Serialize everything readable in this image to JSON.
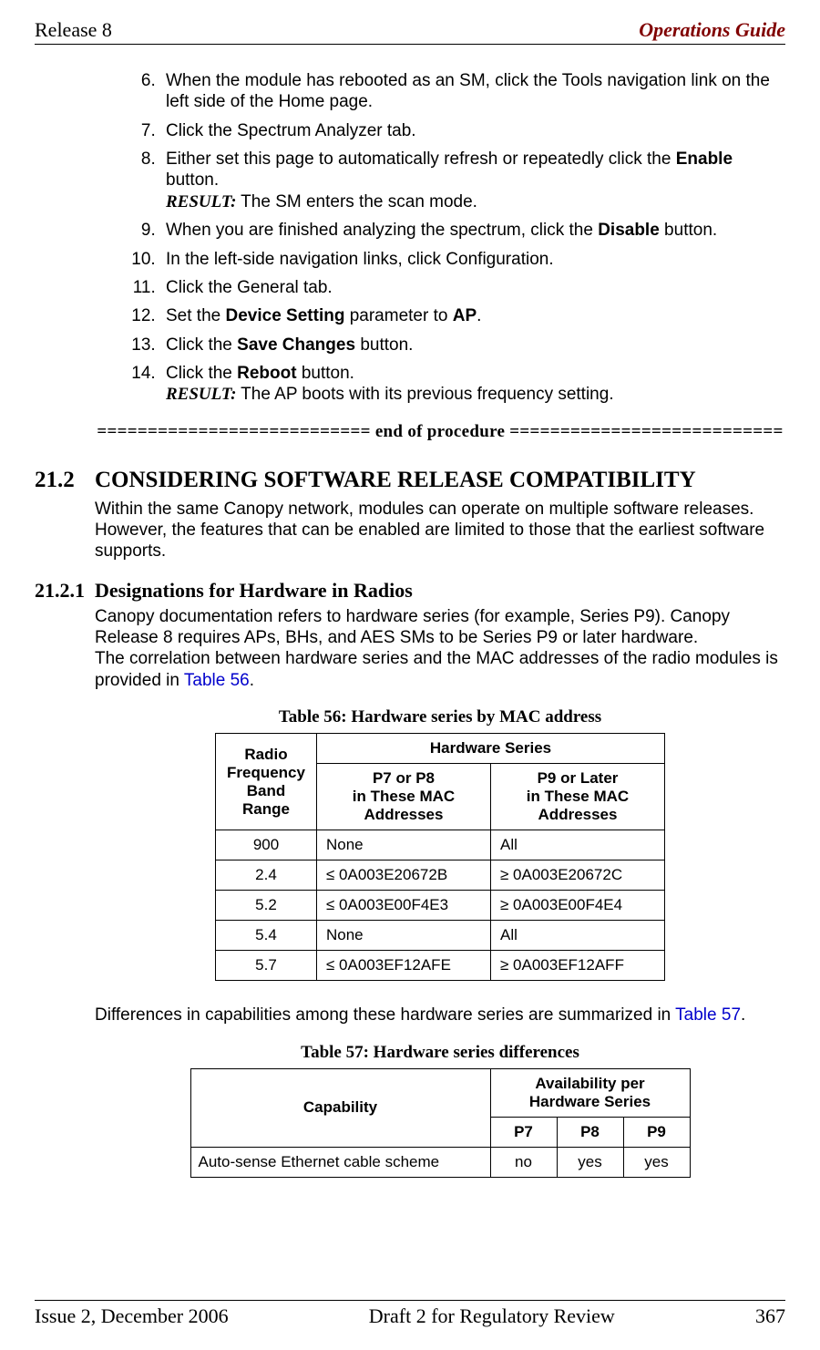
{
  "header": {
    "left": "Release 8",
    "right": "Operations Guide"
  },
  "proc": {
    "start": 6,
    "items": [
      {
        "text": "When the module has rebooted as an SM, click the Tools navigation link on the left side of the Home page."
      },
      {
        "text": "Click the Spectrum Analyzer tab."
      },
      {
        "pre": "Either set this page to automatically refresh or repeatedly click the ",
        "bold": "Enable",
        "post": " button.",
        "result": "The SM enters the scan mode."
      },
      {
        "pre": "When you are finished analyzing the spectrum, click the ",
        "bold": "Disable",
        "post": " button."
      },
      {
        "text": "In the left-side navigation links, click Configuration."
      },
      {
        "text": "Click the General tab."
      },
      {
        "pre": "Set the ",
        "bold": "Device Setting",
        "mid": " parameter to ",
        "bold2": "AP",
        "post": "."
      },
      {
        "pre": "Click the ",
        "bold": "Save Changes",
        "post": " button."
      },
      {
        "pre": "Click the ",
        "bold": "Reboot",
        "post": " button.",
        "result": "The AP boots with its previous frequency setting."
      }
    ]
  },
  "end_of_procedure": "=========================== end of procedure ===========================",
  "s21_2": {
    "num": "21.2",
    "title": "CONSIDERING SOFTWARE RELEASE COMPATIBILITY",
    "para": "Within the same Canopy network, modules can operate on multiple software releases. However, the features that can be enabled are limited to those that the earliest software supports."
  },
  "s21_2_1": {
    "num": "21.2.1",
    "title": "Designations for Hardware in Radios",
    "para_pre": "Canopy documentation refers to hardware series (for example, Series P9). Canopy Release 8 requires APs, BHs, and AES SMs to be Series P9 or later hardware.\nThe correlation between hardware series and the MAC addresses of the radio modules is provided in ",
    "para_link": "Table 56",
    "para_post": "."
  },
  "table56": {
    "caption": "Table 56: Hardware series by MAC address",
    "col0": "Radio Frequency Band Range",
    "colgroup": "Hardware Series",
    "col1": "P7 or P8\nin These MAC Addresses",
    "col2": "P9 or Later\nin These MAC Addresses",
    "rows": [
      {
        "rf": "900",
        "c1": "None",
        "c2": "All"
      },
      {
        "rf": "2.4",
        "c1": "≤ 0A003E20672B",
        "c2": "≥ 0A003E20672C"
      },
      {
        "rf": "5.2",
        "c1": "≤ 0A003E00F4E3",
        "c2": "≥ 0A003E00F4E4"
      },
      {
        "rf": "5.4",
        "c1": "None",
        "c2": "All"
      },
      {
        "rf": "5.7",
        "c1": "≤ 0A003EF12AFE",
        "c2": "≥ 0A003EF12AFF"
      }
    ]
  },
  "diff_para_pre": "Differences in capabilities among these hardware series are summarized in ",
  "diff_para_link": "Table 57",
  "diff_para_post": ".",
  "table57": {
    "caption": "Table 57: Hardware series differences",
    "col0": "Capability",
    "colgroup": "Availability per Hardware Series",
    "c1": "P7",
    "c2": "P8",
    "c3": "P9",
    "rows": [
      {
        "cap": "Auto-sense Ethernet cable scheme",
        "p7": "no",
        "p8": "yes",
        "p9": "yes"
      }
    ]
  },
  "footer": {
    "left": "Issue 2, December 2006",
    "mid": "Draft 2 for Regulatory Review",
    "right": "367"
  },
  "labels": {
    "result": "RESULT:"
  }
}
